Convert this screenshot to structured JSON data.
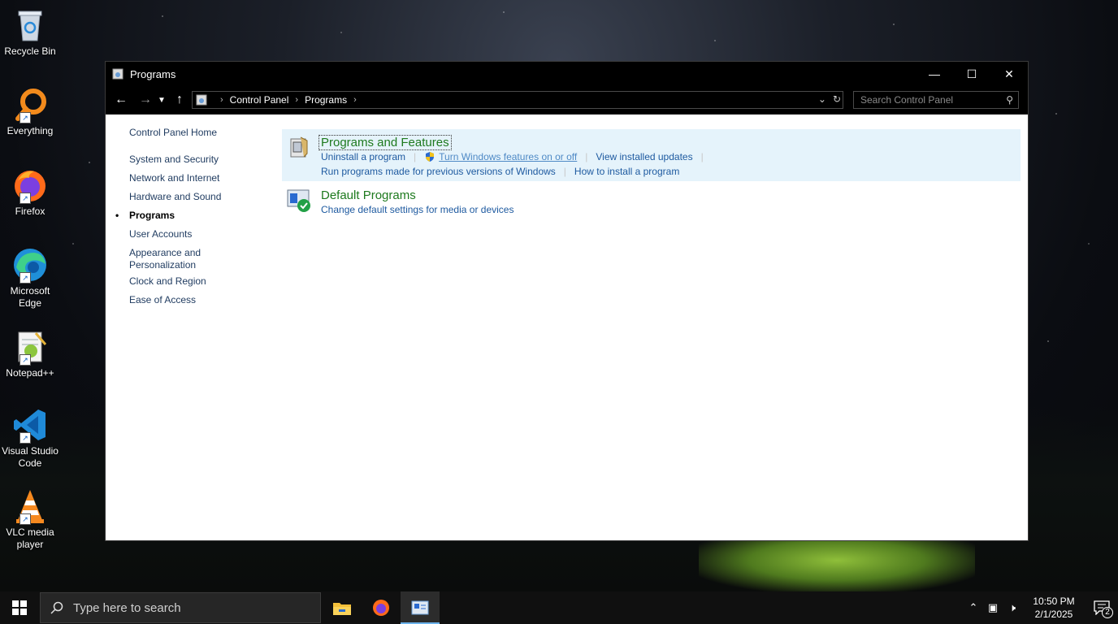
{
  "desktop": {
    "icons": [
      {
        "label": "Recycle Bin"
      },
      {
        "label": "Everything"
      },
      {
        "label": "Firefox"
      },
      {
        "label": "Microsoft Edge"
      },
      {
        "label": "Notepad++"
      },
      {
        "label": "Visual Studio Code"
      },
      {
        "label": "VLC media player"
      }
    ]
  },
  "window": {
    "title": "Programs",
    "breadcrumb": [
      "Control Panel",
      "Programs"
    ],
    "search_placeholder": "Search Control Panel"
  },
  "leftnav": {
    "home": "Control Panel Home",
    "items": [
      "System and Security",
      "Network and Internet",
      "Hardware and Sound",
      "Programs",
      "User Accounts",
      "Appearance and Personalization",
      "Clock and Region",
      "Ease of Access"
    ],
    "current": "Programs"
  },
  "categories": {
    "programs_features": {
      "title": "Programs and Features",
      "links": [
        "Uninstall a program",
        "Turn Windows features on or off",
        "View installed updates",
        "Run programs made for previous versions of Windows",
        "How to install a program"
      ]
    },
    "default_programs": {
      "title": "Default Programs",
      "links": [
        "Change default settings for media or devices"
      ]
    }
  },
  "taskbar": {
    "search_text": "Type here to search",
    "time": "10:50 PM",
    "date": "2/1/2025",
    "notification_count": "2"
  },
  "colors": {
    "heading_green": "#1e7a1e",
    "link_blue": "#1e5aa0",
    "panel_highlight": "#e5f3fb",
    "taskbar_bg": "#101010"
  }
}
